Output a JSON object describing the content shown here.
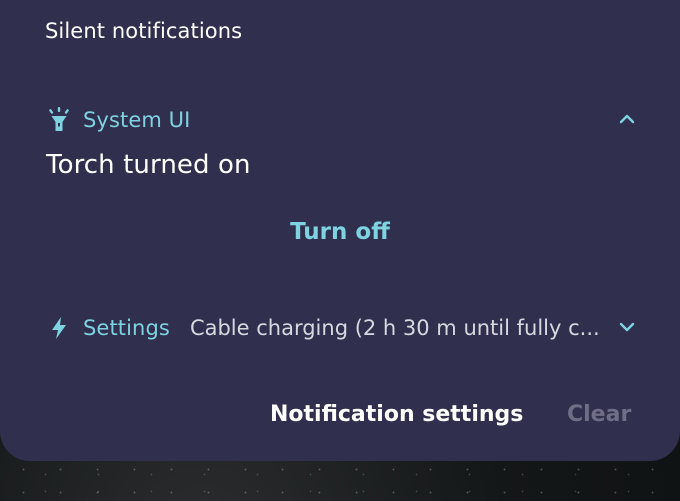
{
  "section": {
    "title": "Silent notifications"
  },
  "torch_notification": {
    "app_name": "System UI",
    "app_icon": "torch-icon",
    "message": "Torch turned on",
    "action_label": "Turn off",
    "expand_state": "chevron-up-icon"
  },
  "charging_notification": {
    "app_name": "Settings",
    "app_icon": "bolt-icon",
    "summary": "Cable charging (2 h 30 m until fully c...",
    "expand_state": "chevron-down-icon"
  },
  "footer": {
    "settings_label": "Notification settings",
    "clear_label": "Clear"
  },
  "colors": {
    "panel_background": "#302f4d",
    "accent": "#7fd2e0",
    "disabled_text": "#6f6e86"
  }
}
